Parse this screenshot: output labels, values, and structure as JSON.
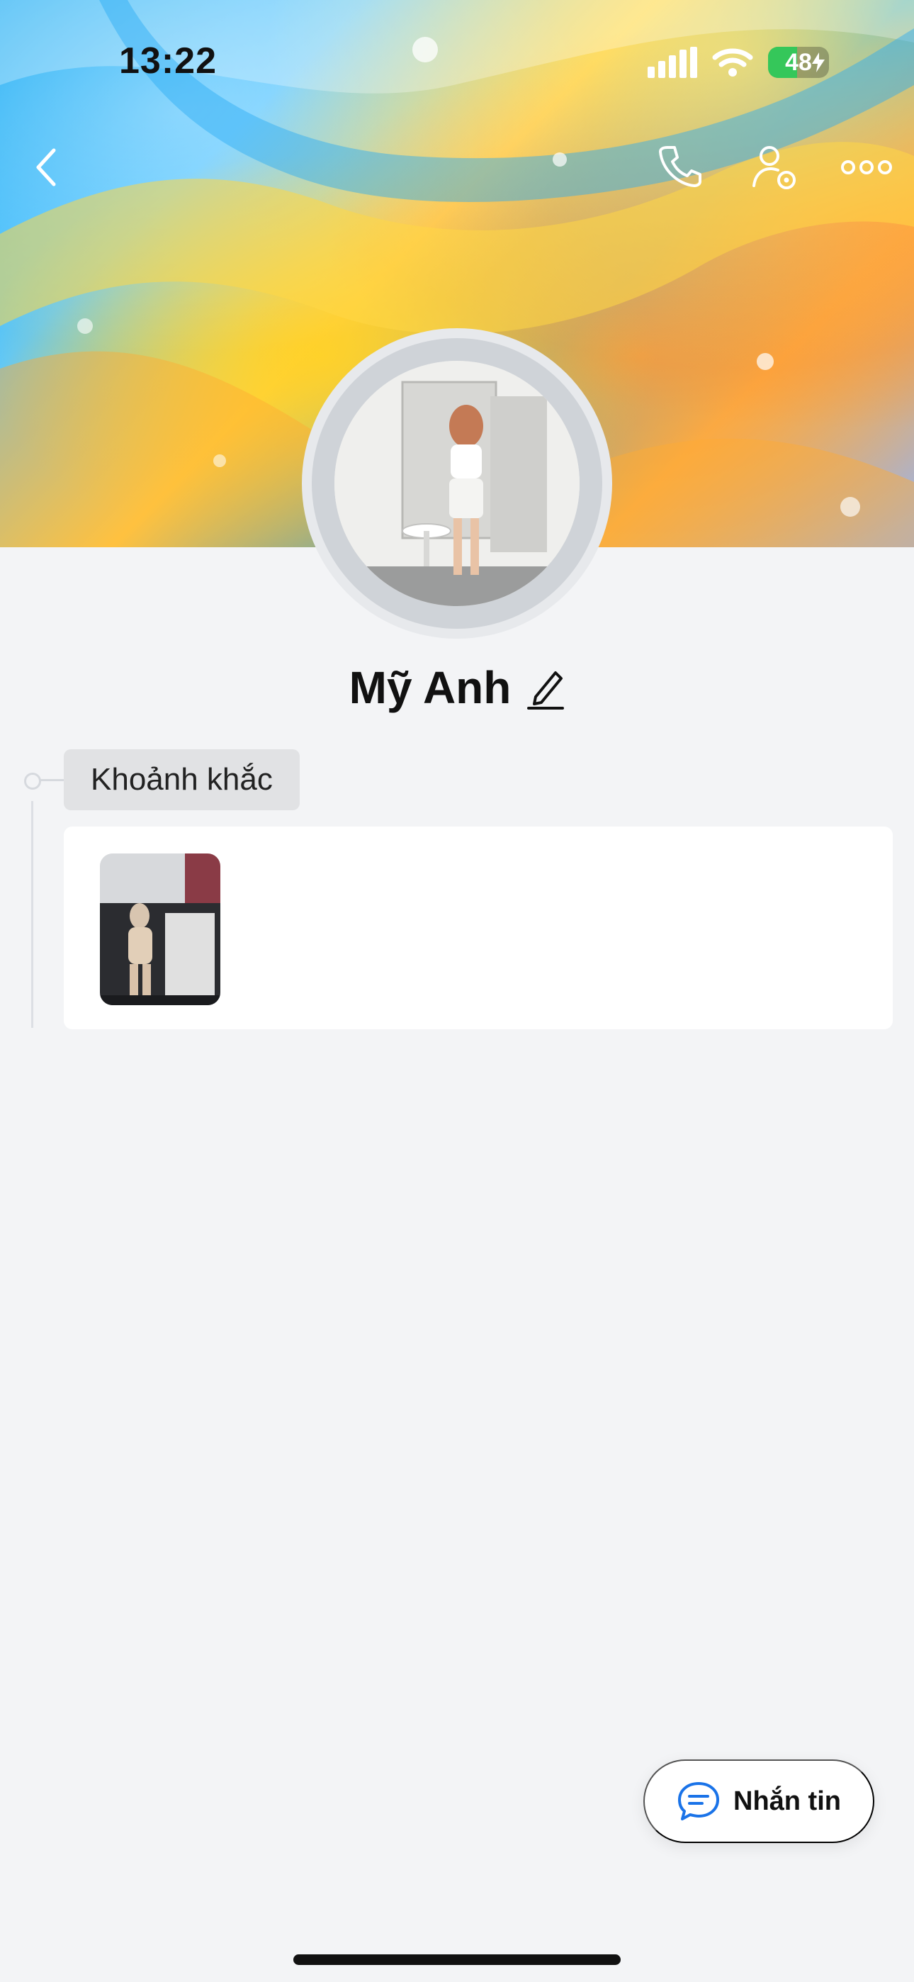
{
  "status_bar": {
    "time": "13:22",
    "battery_level": "48",
    "battery_fill_fraction": 0.48,
    "battery_color": "#35c75a",
    "signal_icon": "cellular-signal-icon",
    "wifi_icon": "wifi-icon",
    "charging_icon": "lightning-icon"
  },
  "header": {
    "back_icon": "chevron-left-icon",
    "call_icon": "phone-icon",
    "profile_settings_icon": "user-gear-icon",
    "more_icon": "more-horizontal-icon"
  },
  "profile": {
    "name": "Mỹ Anh",
    "edit_icon": "pencil-icon"
  },
  "moments": {
    "section_label": "Khoảnh khắc"
  },
  "actions": {
    "message_label": "Nhắn tin",
    "message_icon": "chat-bubble-icon",
    "accent_color": "#1a73e8"
  }
}
